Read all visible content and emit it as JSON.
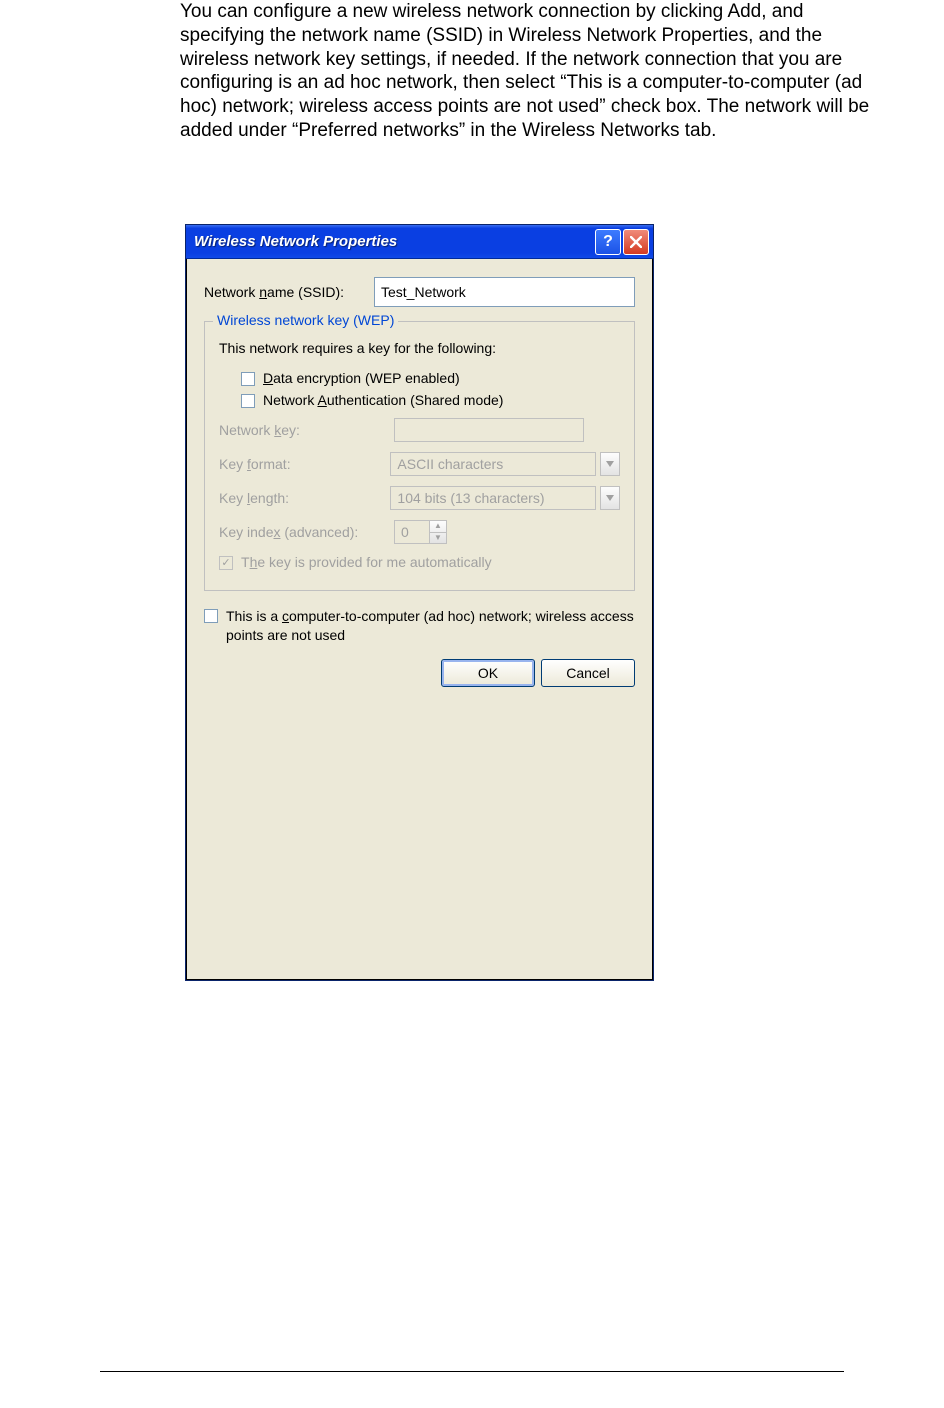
{
  "intro_paragraph": "You can configure a new wireless network connection by clicking Add, and specifying the network name (SSID) in Wireless Network Properties, and the wireless network key settings, if needed. If the network connection that you are configuring is an ad hoc network, then select “This is a computer-to-computer (ad hoc) network; wireless access points are not used” check box. The network will be added under “Preferred networks” in the Wireless Networks tab.",
  "dialog": {
    "title": "Wireless Network Properties",
    "ssid_label_pre": "Network ",
    "ssid_label_ul": "n",
    "ssid_label_post": "ame (SSID):",
    "ssid_value": "Test_Network",
    "group_legend": "Wireless network key (WEP)",
    "requires_text": "This network requires a key for the following:",
    "cb_data_encryption_ul": "D",
    "cb_data_encryption_post": "ata encryption (WEP enabled)",
    "cb_net_auth_pre": "Network ",
    "cb_net_auth_ul": "A",
    "cb_net_auth_post": "uthentication (Shared mode)",
    "key_label_pre": "Network ",
    "key_label_ul": "k",
    "key_label_post": "ey:",
    "key_value": "",
    "format_label_pre": "Key ",
    "format_label_ul": "f",
    "format_label_post": "ormat:",
    "format_value": "ASCII characters",
    "length_label_pre": "Key ",
    "length_label_ul": "l",
    "length_label_post": "ength:",
    "length_value": "104 bits (13 characters)",
    "index_label_pre": "Key inde",
    "index_label_ul": "x",
    "index_label_post": " (advanced):",
    "index_value": "0",
    "auto_key_pre": "T",
    "auto_key_ul": "h",
    "auto_key_post": "e key is provided for me automatically",
    "adhoc_pre": "This is a ",
    "adhoc_ul": "c",
    "adhoc_post": "omputer-to-computer (ad hoc) network; wireless access points are not used",
    "ok_label": "OK",
    "cancel_label": "Cancel"
  }
}
